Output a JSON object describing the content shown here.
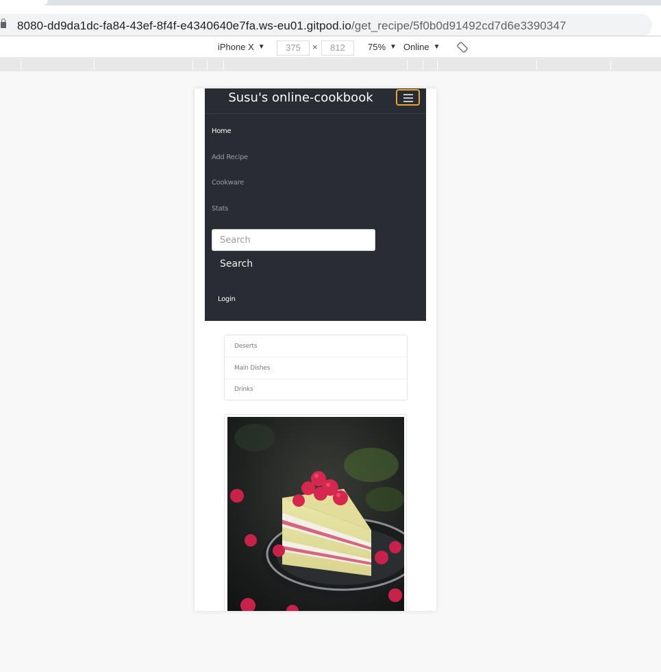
{
  "browser": {
    "url_host": "8080-dd9da1dc-fa84-43ef-8f4f-e4340640e7fa.ws-eu01.gitpod.io",
    "url_path": "/get_recipe/5f0b0d91492cd7d6e3390347"
  },
  "device_toolbar": {
    "device": "iPhone X",
    "width": "375",
    "times": "×",
    "height": "812",
    "zoom": "75%",
    "network": "Online"
  },
  "site": {
    "brand": "Susu's online-cookbook",
    "nav": [
      "Home",
      "Add Recipe",
      "Cookware",
      "Stats"
    ],
    "search_placeholder": "Search",
    "search_button": "Search",
    "login": "Login"
  },
  "categories": [
    "Deserts",
    "Main Dishes",
    "Drinks"
  ],
  "icons": {
    "lock": "lock-icon",
    "dropdown": "caret-down-icon",
    "rotate": "rotate-icon",
    "menu": "hamburger-icon"
  },
  "colors": {
    "navbar": "#2a2c33",
    "toggler_border": "#e8a838"
  }
}
